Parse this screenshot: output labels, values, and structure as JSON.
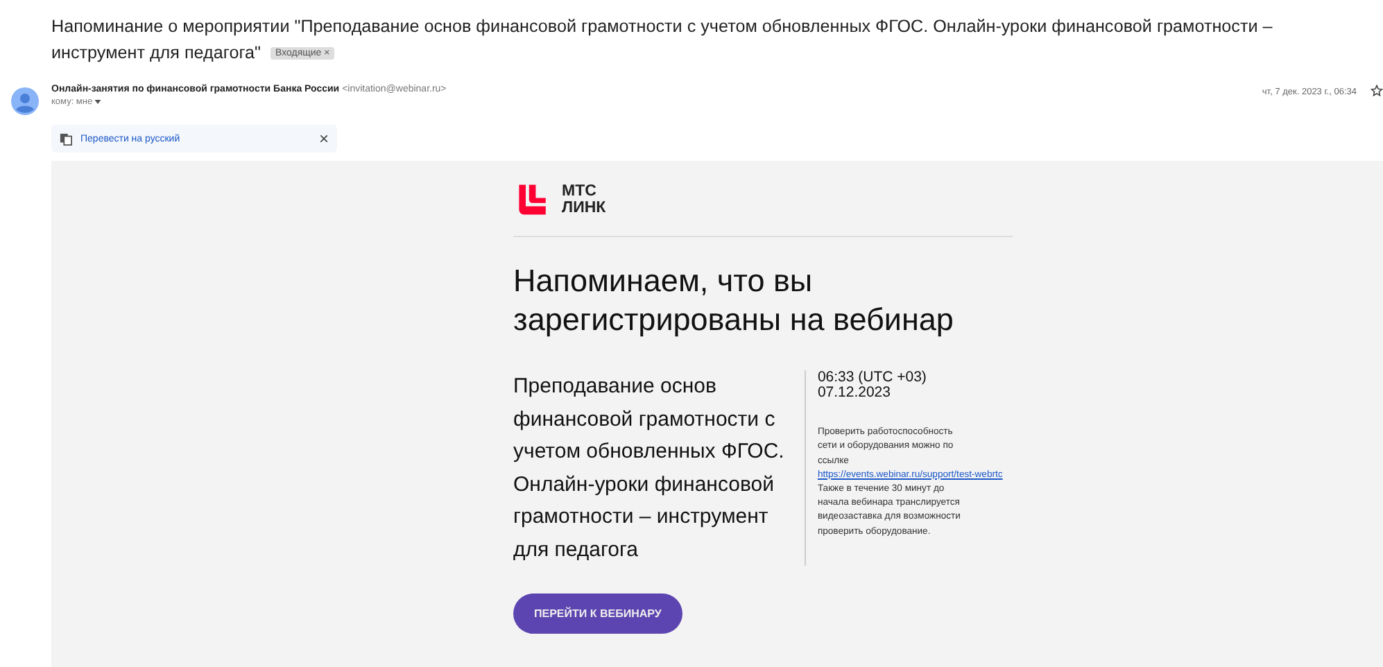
{
  "subject": "Напоминание о мероприятии \"Преподавание основ финансовой грамотности с учетом обновленных ФГОС. Онлайн-уроки финансовой грамотности – инструмент для педагога\"",
  "label": {
    "text": "Входящие",
    "close": "×"
  },
  "sender": {
    "name": "Онлайн-занятия по финансовой грамотности Банка России",
    "email": "<invitation@webinar.ru>",
    "to": "кому: мне",
    "date": "чт, 7 дек. 2023 г., 06:34",
    "starred": false
  },
  "translate": {
    "text": "Перевести на русский",
    "close": "×"
  },
  "body": {
    "logo": [
      "МТС",
      "ЛИНК"
    ],
    "heading": "Напоминаем, что вы зарегистрированы на вебинар",
    "title": "Преподавание основ финансовой грамотности с учетом обновленных ФГОС. Онлайн-уроки финансовой грамотности – инструмент для педагога",
    "time": "06:33 (UTC +03)",
    "date": "07.12.2023",
    "note_before": "Проверить работоспособность сети и оборудования можно по ссылке",
    "link": "https://events.webinar.ru/support/test-webrtc",
    "note_after": "Также в течение 30 минут до начала вебинара транслируется видеозаставка для возможности проверить оборудование.",
    "button": "ПЕРЕЙТИ К ВЕБИНАРУ"
  }
}
